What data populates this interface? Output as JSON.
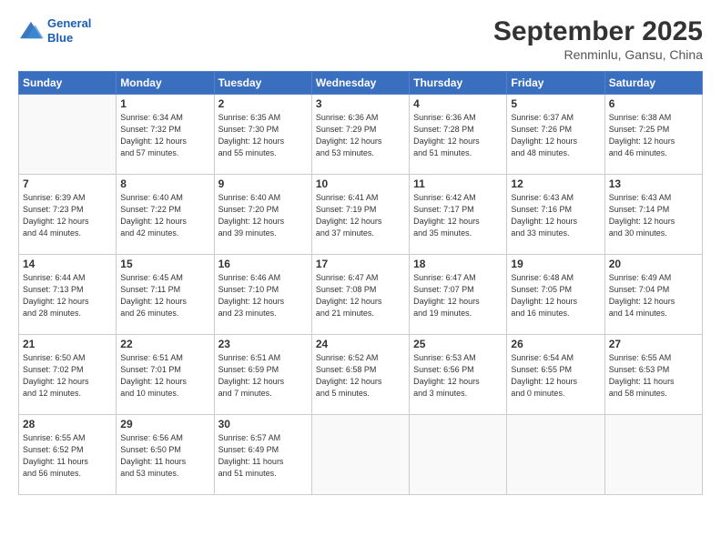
{
  "header": {
    "logo_line1": "General",
    "logo_line2": "Blue",
    "month_title": "September 2025",
    "location": "Renminlu, Gansu, China"
  },
  "weekdays": [
    "Sunday",
    "Monday",
    "Tuesday",
    "Wednesday",
    "Thursday",
    "Friday",
    "Saturday"
  ],
  "weeks": [
    [
      {
        "day": "",
        "info": ""
      },
      {
        "day": "1",
        "info": "Sunrise: 6:34 AM\nSunset: 7:32 PM\nDaylight: 12 hours\nand 57 minutes."
      },
      {
        "day": "2",
        "info": "Sunrise: 6:35 AM\nSunset: 7:30 PM\nDaylight: 12 hours\nand 55 minutes."
      },
      {
        "day": "3",
        "info": "Sunrise: 6:36 AM\nSunset: 7:29 PM\nDaylight: 12 hours\nand 53 minutes."
      },
      {
        "day": "4",
        "info": "Sunrise: 6:36 AM\nSunset: 7:28 PM\nDaylight: 12 hours\nand 51 minutes."
      },
      {
        "day": "5",
        "info": "Sunrise: 6:37 AM\nSunset: 7:26 PM\nDaylight: 12 hours\nand 48 minutes."
      },
      {
        "day": "6",
        "info": "Sunrise: 6:38 AM\nSunset: 7:25 PM\nDaylight: 12 hours\nand 46 minutes."
      }
    ],
    [
      {
        "day": "7",
        "info": "Sunrise: 6:39 AM\nSunset: 7:23 PM\nDaylight: 12 hours\nand 44 minutes."
      },
      {
        "day": "8",
        "info": "Sunrise: 6:40 AM\nSunset: 7:22 PM\nDaylight: 12 hours\nand 42 minutes."
      },
      {
        "day": "9",
        "info": "Sunrise: 6:40 AM\nSunset: 7:20 PM\nDaylight: 12 hours\nand 39 minutes."
      },
      {
        "day": "10",
        "info": "Sunrise: 6:41 AM\nSunset: 7:19 PM\nDaylight: 12 hours\nand 37 minutes."
      },
      {
        "day": "11",
        "info": "Sunrise: 6:42 AM\nSunset: 7:17 PM\nDaylight: 12 hours\nand 35 minutes."
      },
      {
        "day": "12",
        "info": "Sunrise: 6:43 AM\nSunset: 7:16 PM\nDaylight: 12 hours\nand 33 minutes."
      },
      {
        "day": "13",
        "info": "Sunrise: 6:43 AM\nSunset: 7:14 PM\nDaylight: 12 hours\nand 30 minutes."
      }
    ],
    [
      {
        "day": "14",
        "info": "Sunrise: 6:44 AM\nSunset: 7:13 PM\nDaylight: 12 hours\nand 28 minutes."
      },
      {
        "day": "15",
        "info": "Sunrise: 6:45 AM\nSunset: 7:11 PM\nDaylight: 12 hours\nand 26 minutes."
      },
      {
        "day": "16",
        "info": "Sunrise: 6:46 AM\nSunset: 7:10 PM\nDaylight: 12 hours\nand 23 minutes."
      },
      {
        "day": "17",
        "info": "Sunrise: 6:47 AM\nSunset: 7:08 PM\nDaylight: 12 hours\nand 21 minutes."
      },
      {
        "day": "18",
        "info": "Sunrise: 6:47 AM\nSunset: 7:07 PM\nDaylight: 12 hours\nand 19 minutes."
      },
      {
        "day": "19",
        "info": "Sunrise: 6:48 AM\nSunset: 7:05 PM\nDaylight: 12 hours\nand 16 minutes."
      },
      {
        "day": "20",
        "info": "Sunrise: 6:49 AM\nSunset: 7:04 PM\nDaylight: 12 hours\nand 14 minutes."
      }
    ],
    [
      {
        "day": "21",
        "info": "Sunrise: 6:50 AM\nSunset: 7:02 PM\nDaylight: 12 hours\nand 12 minutes."
      },
      {
        "day": "22",
        "info": "Sunrise: 6:51 AM\nSunset: 7:01 PM\nDaylight: 12 hours\nand 10 minutes."
      },
      {
        "day": "23",
        "info": "Sunrise: 6:51 AM\nSunset: 6:59 PM\nDaylight: 12 hours\nand 7 minutes."
      },
      {
        "day": "24",
        "info": "Sunrise: 6:52 AM\nSunset: 6:58 PM\nDaylight: 12 hours\nand 5 minutes."
      },
      {
        "day": "25",
        "info": "Sunrise: 6:53 AM\nSunset: 6:56 PM\nDaylight: 12 hours\nand 3 minutes."
      },
      {
        "day": "26",
        "info": "Sunrise: 6:54 AM\nSunset: 6:55 PM\nDaylight: 12 hours\nand 0 minutes."
      },
      {
        "day": "27",
        "info": "Sunrise: 6:55 AM\nSunset: 6:53 PM\nDaylight: 11 hours\nand 58 minutes."
      }
    ],
    [
      {
        "day": "28",
        "info": "Sunrise: 6:55 AM\nSunset: 6:52 PM\nDaylight: 11 hours\nand 56 minutes."
      },
      {
        "day": "29",
        "info": "Sunrise: 6:56 AM\nSunset: 6:50 PM\nDaylight: 11 hours\nand 53 minutes."
      },
      {
        "day": "30",
        "info": "Sunrise: 6:57 AM\nSunset: 6:49 PM\nDaylight: 11 hours\nand 51 minutes."
      },
      {
        "day": "",
        "info": ""
      },
      {
        "day": "",
        "info": ""
      },
      {
        "day": "",
        "info": ""
      },
      {
        "day": "",
        "info": ""
      }
    ]
  ]
}
